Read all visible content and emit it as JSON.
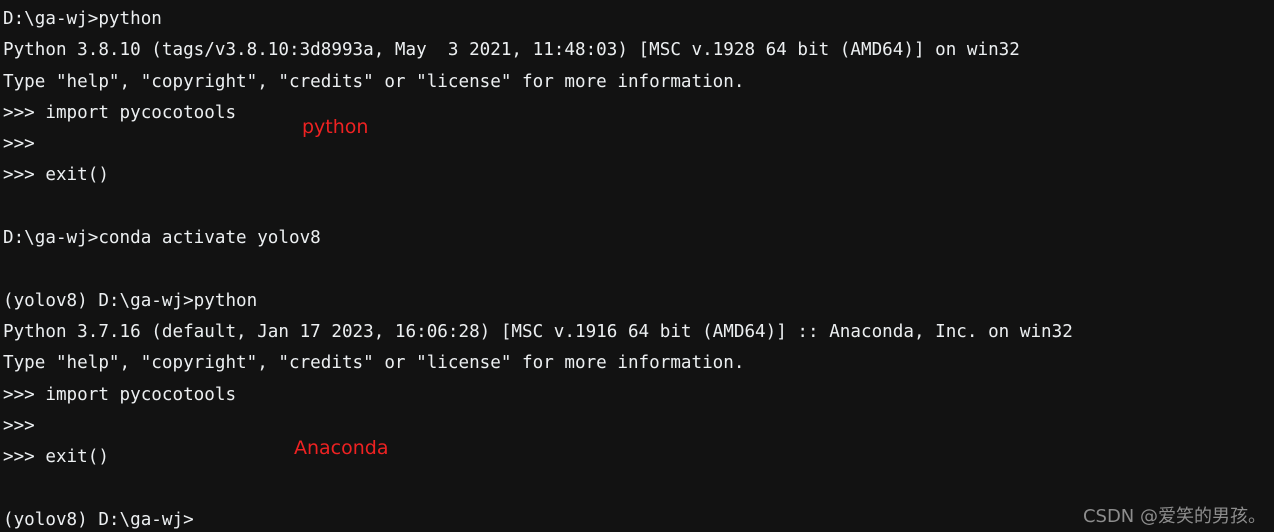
{
  "terminal": {
    "background_color": "#121212",
    "text_color": "#eceff1",
    "annotation_color": "#ee2222",
    "watermark_color": "#8d8d8d",
    "lines": [
      {
        "text": "D:\\ga-wj>python"
      },
      {
        "text": "Python 3.8.10 (tags/v3.8.10:3d8993a, May  3 2021, 11:48:03) [MSC v.1928 64 bit (AMD64)] on win32"
      },
      {
        "text": "Type \"help\", \"copyright\", \"credits\" or \"license\" for more information."
      },
      {
        "text": ">>> import pycocotools"
      },
      {
        "text": ">>>"
      },
      {
        "text": ">>> exit()"
      },
      {
        "text": ""
      },
      {
        "text": "D:\\ga-wj>conda activate yolov8"
      },
      {
        "text": ""
      },
      {
        "text": "(yolov8) D:\\ga-wj>python"
      },
      {
        "text": "Python 3.7.16 (default, Jan 17 2023, 16:06:28) [MSC v.1916 64 bit (AMD64)] :: Anaconda, Inc. on win32"
      },
      {
        "text": "Type \"help\", \"copyright\", \"credits\" or \"license\" for more information."
      },
      {
        "text": ">>> import pycocotools"
      },
      {
        "text": ">>>"
      },
      {
        "text": ">>> exit()"
      },
      {
        "text": ""
      },
      {
        "text": "(yolov8) D:\\ga-wj>"
      }
    ]
  },
  "annotations": {
    "python": "python",
    "anaconda": "Anaconda"
  },
  "watermark": {
    "text": "CSDN @爱笑的男孩。"
  }
}
